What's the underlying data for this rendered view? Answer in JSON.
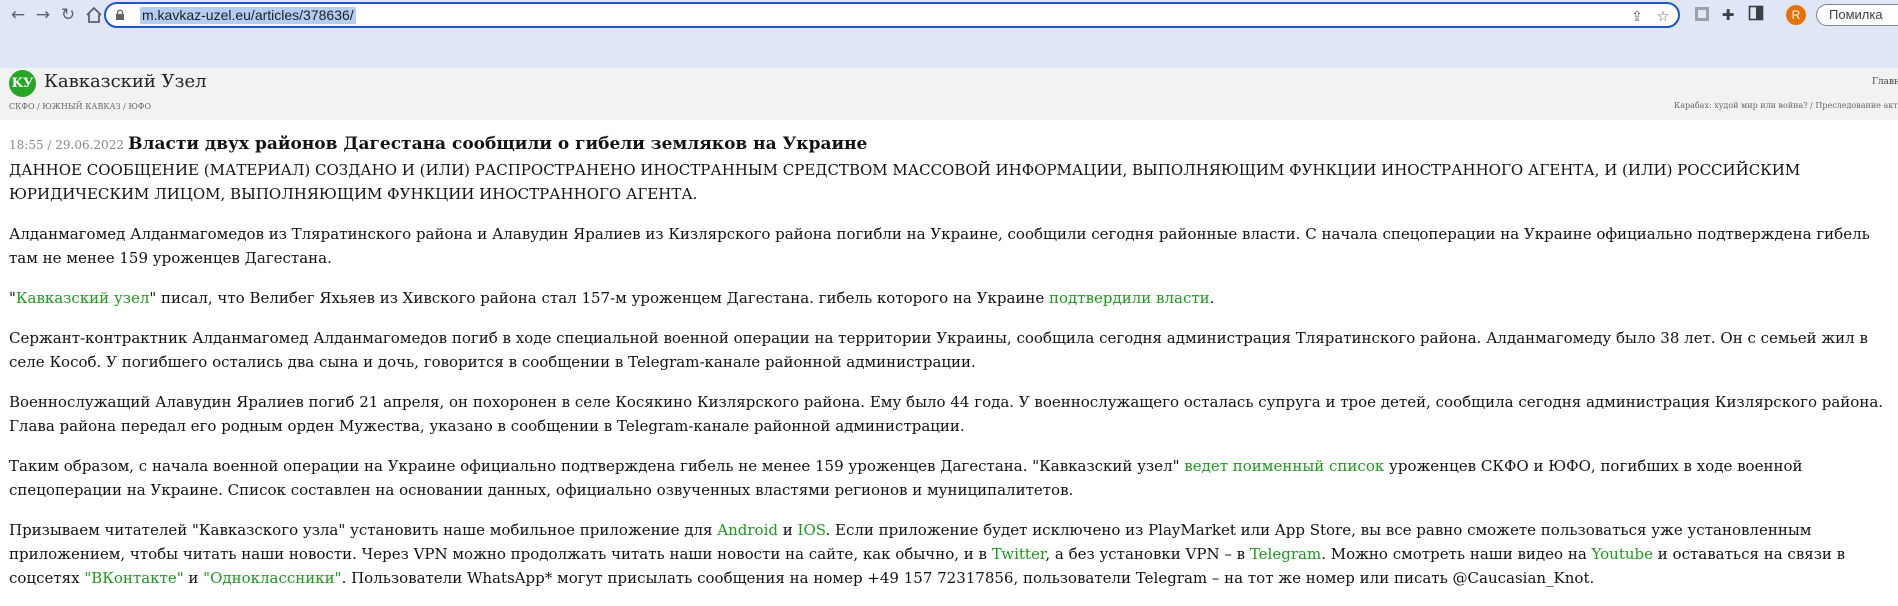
{
  "browser": {
    "url": "m.kavkaz-uzel.eu/articles/378636/",
    "error_button_label": "Помилка",
    "profile_initial": "R",
    "icons": [
      "back-arrow-icon",
      "forward-arrow-icon",
      "reload-icon",
      "lock-icon",
      "share-icon",
      "star-icon",
      "extension-icon",
      "puzzle-icon",
      "sidebar-icon",
      "profile-avatar"
    ]
  },
  "site": {
    "title": "Кавказский Узел",
    "logo_text": "KУ",
    "home_link": "Главная",
    "regions": "СКФО / ЮЖНЫЙ КАВКАЗ / ЮФО",
    "tags": "Карабах: худой мир или война? / Преследование активистов",
    "brand_color": "#27a626",
    "link_color": "#1a9a1a"
  },
  "article": {
    "time": "18:55 / 29.06.2022",
    "headline": "Власти двух районов Дагестана сообщили о гибели земляков на Украине",
    "disclaimer": "ДАННОЕ СООБЩЕНИЕ (МАТЕРИАЛ) СОЗДАНО И (ИЛИ) РАСПРОСТРАНЕНО ИНОСТРАННЫМ СРЕДСТВОМ МАССОВОЙ ИНФОРМАЦИИ, ВЫПОЛНЯЮЩИМ ФУНКЦИИ ИНОСТРАННОГО АГЕНТА, И (ИЛИ) РОССИЙСКИМ ЮРИДИЧЕСКИМ ЛИЦОМ, ВЫПОЛНЯЮЩИМ ФУНКЦИИ ИНОСТРАННОГО АГЕНТА.",
    "p1": "Алданмагомед Алданмагомедов из Тляратинского района и Алавудин Яралиев из Кизлярского района погибли на Украине, сообщили сегодня районные власти. С начала спецоперации на Украине официально подтверждена гибель там не менее 159 уроженцев Дагестана.",
    "p2": {
      "q_open": "\"",
      "link1": "Кавказский узел",
      "text1": "\" писал, что Велибег Яхьяев из Хивского района стал 157-м уроженцем Дагестана. гибель которого на Украине ",
      "link2": "подтвердили власти",
      "text2": "."
    },
    "p3": "Сержант-контрактник Алданмагомед Алданмагомедов  погиб в ходе специальной военной операции на территории Украины, сообщила сегодня администрация Тляратинского района. Алданмагомеду было 38 лет. Он с семьей жил в селе Кособ. У погибшего остались два сына и дочь, говорится в сообщении в Telegram-канале районной администрации.",
    "p4": "Военнослужащий Алавудин  Яралиев погиб 21 апреля,  он похоронен в селе Косякино Кизлярского района. Ему было 44 года. У военнослужащего осталась супруга и трое детей, сообщила сегодня администрация Кизлярского района. Глава района передал его родным орден Мужества, указано в сообщении в Telegram-канале районной администрации.",
    "p5": {
      "text1": "Таким образом, с начала военной операции на Украине официально подтверждена гибель не менее 159 уроженцев Дагестана. \"Кавказский узел\" ",
      "link1": "ведет поименный список",
      "text2": " уроженцев СКФО и ЮФО, погибших в ходе военной спецоперации на Украине. Список составлен на основании данных, официально озвученных властями регионов и муниципалитетов."
    },
    "p6": {
      "text1": "Призываем читателей \"Кавказского узла\" установить наше мобильное приложение для ",
      "link_android": "Android",
      "and": " и ",
      "link_ios": "IOS",
      "text2": ". Если приложение будет исключено из PlayMarket или App Store, вы все равно сможете пользоваться уже установленным приложением, чтобы читать наши новости. Через VPN можно продолжать читать наши новости на сайте, как обычно, и в ",
      "link_twitter": "Twitter",
      "text3": ", а без установки VPN – в ",
      "link_telegram": "Telegram",
      "text4": ". Можно смотреть наши видео на ",
      "link_youtube": "Youtube",
      "text5": " и оставаться на связи в соцсетях ",
      "link_vk": "\"ВКонтакте\"",
      "and2": " и ",
      "link_ok": "\"Одноклассники\"",
      "text6": ". Пользователи WhatsApp* могут присылать сообщения на номер +49 157 72317856, пользователи Telegram – на тот же номер или писать @Caucasian_Knot."
    }
  }
}
